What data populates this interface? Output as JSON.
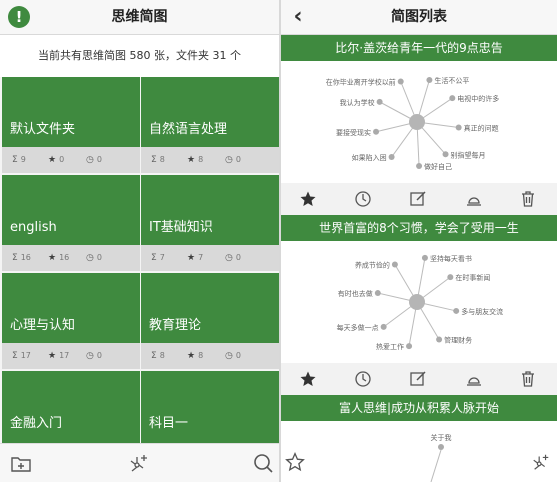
{
  "left": {
    "title": "思维简图",
    "logo_glyph": "!",
    "count_text": "当前共有思维简图 580 张，文件夹 31 个",
    "folders": [
      {
        "name": "默认文件夹",
        "sigma": "9",
        "stars": "0",
        "clock": "0"
      },
      {
        "name": "自然语言处理",
        "sigma": "8",
        "stars": "8",
        "clock": "0"
      },
      {
        "name": "english",
        "sigma": "16",
        "stars": "16",
        "clock": "0"
      },
      {
        "name": "IT基础知识",
        "sigma": "7",
        "stars": "7",
        "clock": "0"
      },
      {
        "name": "心理与认知",
        "sigma": "17",
        "stars": "17",
        "clock": "0"
      },
      {
        "name": "教育理论",
        "sigma": "8",
        "stars": "8",
        "clock": "0"
      },
      {
        "name": "金融入门",
        "sigma": "",
        "stars": "",
        "clock": ""
      },
      {
        "name": "科目一",
        "sigma": "",
        "stars": "",
        "clock": ""
      }
    ]
  },
  "right": {
    "title": "简图列表",
    "back_glyph": "‹",
    "maps": [
      {
        "title": "比尔·盖茨给青年一代的9点忠告",
        "nodes": [
          "生活不公平",
          "电视中的许多",
          "真正的问题",
          "别指望每月",
          "做好自己",
          "如果陷入困",
          "要接受现实",
          "我认为学校",
          "在你毕业离开学校以前"
        ]
      },
      {
        "title": "世界首富的8个习惯，学会了受用一生",
        "nodes": [
          "坚持每天看书",
          "在时事新闻",
          "多与朋友交流",
          "管理财务",
          "热爱工作",
          "每天多做一点",
          "有时也去做",
          "养成节俭的"
        ]
      },
      {
        "title": "富人思维|成功从积累人脉开始",
        "nodes": [
          "关于我"
        ]
      }
    ]
  },
  "colors": {
    "accent": "#3f8a3f",
    "stat_bar": "#d9d9d9"
  }
}
